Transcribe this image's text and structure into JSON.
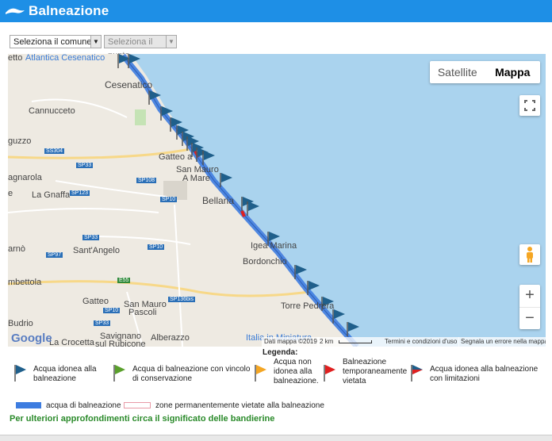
{
  "header": {
    "title": "Balneazione"
  },
  "filters": {
    "comune": "Seleziona il comune",
    "punto": "Seleziona il punto"
  },
  "map": {
    "type_satellite": "Satellite",
    "type_map": "Mappa",
    "labels": {
      "atlantica": "Atlantica Cesenatico",
      "etto": "etto",
      "cesenatico": "Cesenatico",
      "cannucceto": "Cannucceto",
      "guzzo": "guzzo",
      "gatteo_a": "Gatteo a",
      "sanmauro": "San Mauro",
      "amare": "A Mare",
      "agnarola": "agnarola",
      "lagnaffa": "La Gnaffa",
      "e": "e",
      "bellaria": "Bellaria",
      "arno": "arnò",
      "santangelo": "Sant'Angelo",
      "igea": "Igea Marina",
      "bordonchio": "Bordonchio",
      "mbettola": "mbettola",
      "gatteo": "Gatteo",
      "sanmauropascoli1": "San Mauro",
      "sanmauropascoli2": "Pascoli",
      "torrepedrera": "Torre Pedrera",
      "budrio": "Budrio",
      "lacrocetta": "La Crocetta",
      "savignano1": "Savignano",
      "savignano2": "sul Rubicone",
      "alberazzo": "Alberazzo",
      "italia": "Italia in Miniatura"
    },
    "roads": {
      "ss304": "SS304",
      "sp33a": "SP33",
      "sp108": "SP108",
      "sp123": "SP123",
      "sp10a": "SP10",
      "sp33b": "SP33",
      "sp97": "SP97",
      "sp10b": "SP10",
      "e55": "E55",
      "sp136": "SP136bis",
      "sp10c": "SP10",
      "sp33c": "SP33"
    },
    "google": "Google",
    "attribution_data": "Dati mappa ©2019",
    "scale": "2 km",
    "terms": "Termini e condizioni d'uso",
    "report": "Segnala un errore nella mappa"
  },
  "legend": {
    "title": "Legenda:",
    "items": [
      {
        "label": "Acqua idonea alla balneazione",
        "color": "#1f5f8b"
      },
      {
        "label": "Acqua di balneazione con vincolo di conservazione",
        "color": "#5aa02c"
      },
      {
        "label": "Acqua non idonea alla balneazione.",
        "color": "#f4a623"
      },
      {
        "label": "Balneazione temporaneamente vietata",
        "color": "#e02020"
      },
      {
        "label": "Acqua idonea alla balneazione con limitazioni",
        "color": "#1f5f8b"
      }
    ],
    "bars": [
      {
        "label": "acqua di balneazione",
        "color": "#3d7ce0"
      },
      {
        "label": "zone permanentemente vietate alla balneazione",
        "color": "#e89aa6"
      }
    ],
    "link": "Per ulteriori approfondimenti circa il significato delle bandierine"
  }
}
